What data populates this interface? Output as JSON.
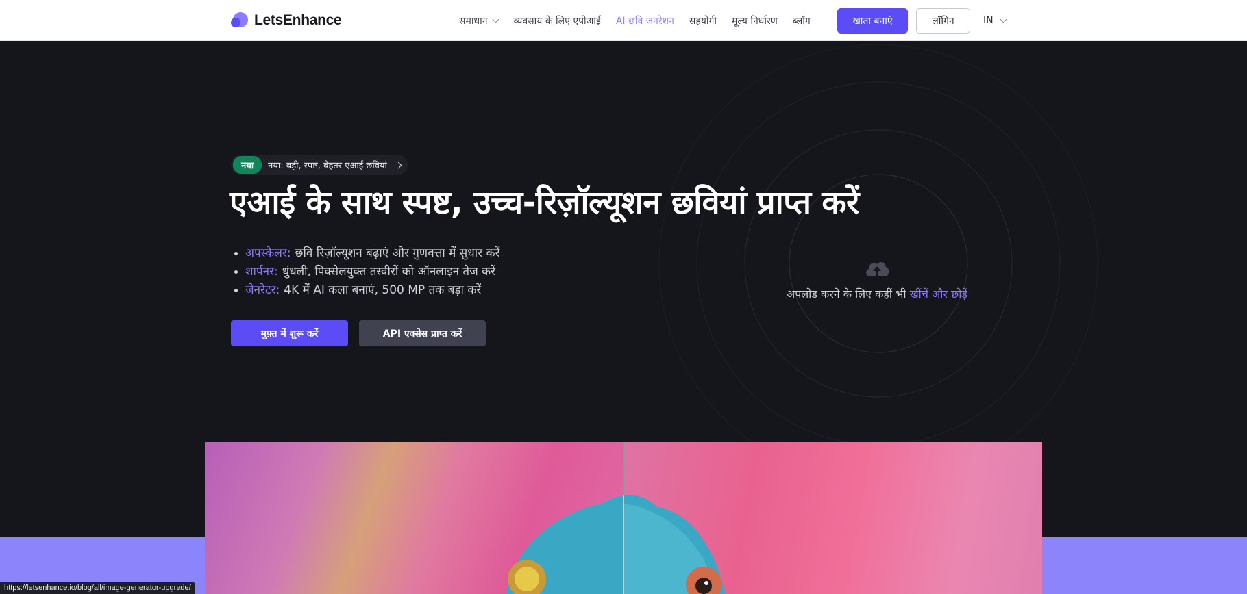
{
  "brand": {
    "name": "LetsEnhance"
  },
  "nav": {
    "items": [
      {
        "label": "समाधान",
        "has_dropdown": true
      },
      {
        "label": "व्यवसाय के लिए एपीआई"
      },
      {
        "label": "AI छवि जनरेशन",
        "active": true
      },
      {
        "label": "सहयोगी"
      },
      {
        "label": "मूल्य निर्धारण"
      },
      {
        "label": "ब्लॉग"
      }
    ],
    "signup_label": "खाता बनाएं",
    "login_label": "लॉगिन",
    "language": "IN"
  },
  "hero": {
    "badge_tag": "नया",
    "badge_text": "नया: बड़ी, स्पष्ट, बेहतर एआई छवियां",
    "headline": "एआई के साथ स्पष्ट, उच्च-रिज़ॉल्यूशन छवियां प्राप्त करें",
    "bullets": [
      {
        "key": "अपस्केलर:",
        "text": "छवि रिज़ॉल्यूशन बढ़ाएं और गुणवत्ता में सुधार करें"
      },
      {
        "key": "शार्पनर:",
        "text": "धुंधली, पिक्सेलयुक्त तस्वीरों को ऑनलाइन तेज करें"
      },
      {
        "key": "जेनरेटर:",
        "text": "4K में AI कला बनाएं, 500 MP तक बड़ा करें"
      }
    ],
    "cta_primary": "मुफ़्त में शुरू करें",
    "cta_secondary": "API एक्सेस प्राप्त करें"
  },
  "upload": {
    "text": "अपलोड करने के लिए कहीं भी",
    "link": "खींचें और छोड़ें"
  },
  "status_bar": {
    "url": "https://letsenhance.io/blog/all/image-generator-upgrade/"
  },
  "colors": {
    "accent": "#5b4cf5",
    "accent_light": "#8c7bff",
    "hero_bg": "#15161c",
    "badge_green": "#12855b",
    "band": "#8b84fb"
  }
}
